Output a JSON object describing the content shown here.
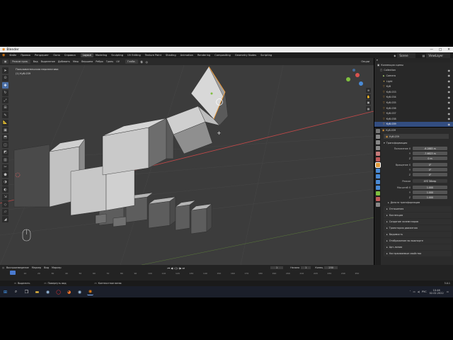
{
  "window": {
    "title": "Blender"
  },
  "menus": [
    "Файл",
    "Правка",
    "Рендеринг",
    "Окно",
    "Справка"
  ],
  "workspaces": [
    "Layout",
    "Modeling",
    "Sculpting",
    "UV Editing",
    "Texture Paint",
    "Shading",
    "Animation",
    "Rendering",
    "Compositing",
    "Geometry Nodes",
    "Scripting"
  ],
  "scene": {
    "name": "Scene",
    "layer": "ViewLayer"
  },
  "viewport_header": {
    "orientation_label": "Ориентация:",
    "orientation_value": "По умолч.",
    "drag_label": "Drag:",
    "drag_value": "Select Box",
    "mode": "Режим прав.",
    "menu": [
      "Вид",
      "Выделение",
      "Добавить",
      "Меш",
      "Вершина",
      "Ребро",
      "Грань",
      "UV"
    ],
    "transform": "Глоба.",
    "options": "Опции"
  },
  "viewport_overlay": {
    "line1": "Пользовательская перспектива",
    "line2": "(1) Куб.039"
  },
  "outliner": {
    "title": "Коллекция сцены",
    "rows": [
      {
        "name": "Collection",
        "selected": false
      },
      {
        "name": "Camera",
        "selected": false
      },
      {
        "name": "Light",
        "selected": false
      },
      {
        "name": "Куб",
        "selected": false
      },
      {
        "name": "Куб.033",
        "selected": false
      },
      {
        "name": "Куб.034",
        "selected": false
      },
      {
        "name": "Куб.035",
        "selected": false
      },
      {
        "name": "Куб.036",
        "selected": false
      },
      {
        "name": "Куб.037",
        "selected": false
      },
      {
        "name": "Куб.038",
        "selected": false
      },
      {
        "name": "Куб.039",
        "selected": true
      }
    ]
  },
  "properties": {
    "object_name": "Куб.039",
    "datablock": "Куб.039",
    "section_transform": "Трансформация",
    "location_label": "Положение X",
    "location": [
      "-6.2883 m",
      "-7.6623 m",
      "0 m"
    ],
    "rotation_label": "Вращение X",
    "rotation": [
      "0°",
      "0°",
      "0°"
    ],
    "mode_label": "Режим",
    "mode_value": "XYZ Эйлер",
    "scale_label": "Масштаб X",
    "scale": [
      "1.000",
      "1.000",
      "1.000"
    ],
    "axis_y": "Y",
    "axis_z": "Z",
    "delta": "Дельта трансформации",
    "panels": [
      "Отношения",
      "Коллекции",
      "Создание экземпляров",
      "Траектория движения",
      "Видимость",
      "Отображение во вьюпорте",
      "Арт-линии",
      "Настраиваемые свойства"
    ]
  },
  "timeline": {
    "menu": [
      "Воспроизведение",
      "Маркер",
      "Вид",
      "Маркер"
    ],
    "current_frame": "1",
    "start_label": "Начало",
    "start": "1",
    "end_label": "Конец",
    "end": "250",
    "ticks": [
      "0",
      "10",
      "20",
      "30",
      "40",
      "50",
      "60",
      "70",
      "80",
      "90",
      "100",
      "110",
      "120",
      "130",
      "140",
      "150",
      "160",
      "170",
      "180",
      "190",
      "200",
      "210",
      "220",
      "230",
      "240",
      "250"
    ]
  },
  "statusbar": {
    "select": "Выделить",
    "rotate": "Повернуть вид",
    "context": "Контекстное меню",
    "version": "3.0.1"
  },
  "taskbar": {
    "time": "10:46",
    "date": "02.02.2022",
    "lang": "РУС"
  },
  "colors": {
    "accent": "#4b6fa6",
    "selected_row": "#334d80",
    "x_axis": "#d9534f",
    "y_axis": "#7fbf3f",
    "z_axis": "#4a8bd6"
  }
}
